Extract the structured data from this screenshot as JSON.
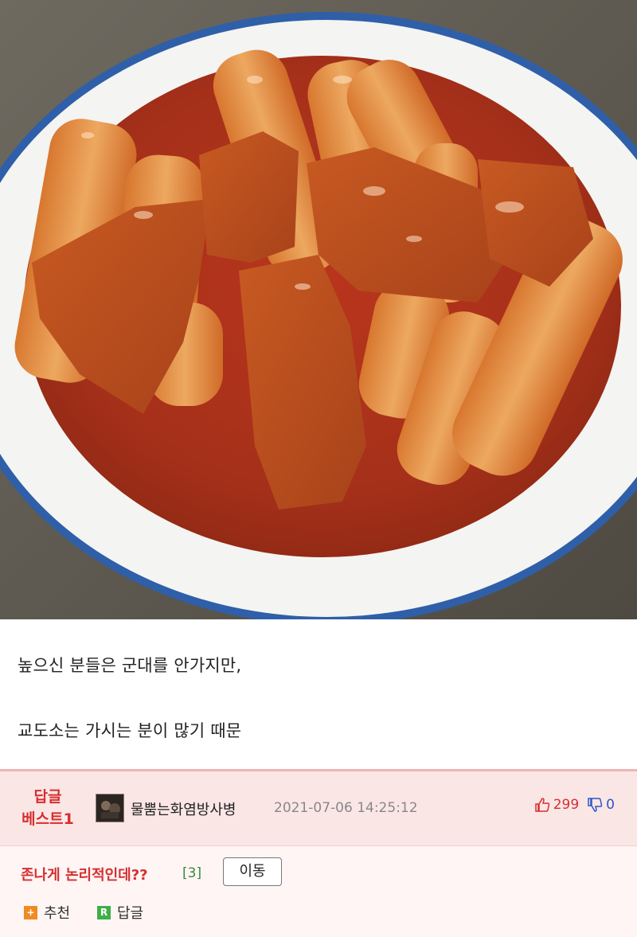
{
  "post": {
    "line1": "높으신 분들은 군대를 안가지만,",
    "line2": "교도소는 가시는 분이 많기 때문"
  },
  "reply": {
    "badge_line1": "답글",
    "badge_line2": "베스트1",
    "nickname": "물뿜는화염방사병",
    "date": "2021-07-06 14:25:12",
    "up_count": "299",
    "down_count": "0",
    "text": "존나게 논리적인데??",
    "comment_count": "[3]",
    "move_label": "이동",
    "recommend_icon_glyph": "+",
    "recommend_label": "추천",
    "reply_icon_glyph": "R",
    "reply_label": "답글"
  },
  "colors": {
    "accent_red": "#d62f2f",
    "down_blue": "#2a56c6",
    "box_border": "#f0b4b4",
    "recommend_orange": "#f08a24",
    "reply_green": "#3fae49"
  }
}
